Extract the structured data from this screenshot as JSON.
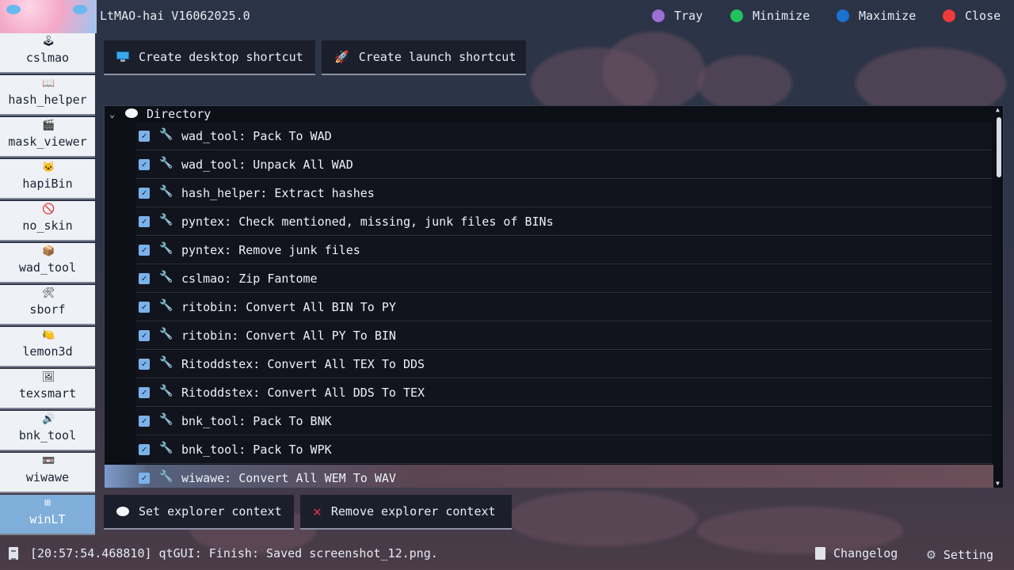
{
  "app": {
    "title": "LtMAO-hai V16062025.0"
  },
  "window_controls": [
    {
      "label": "Tray",
      "color": "#9b6fd4"
    },
    {
      "label": "Minimize",
      "color": "#23c25e"
    },
    {
      "label": "Maximize",
      "color": "#1a73d0"
    },
    {
      "label": "Close",
      "color": "#ef3b3b"
    }
  ],
  "sidebar": {
    "items": [
      {
        "label": "cslmao",
        "icon": "joystick-icon",
        "glyph": "🕹",
        "active": false
      },
      {
        "label": "hash_helper",
        "icon": "open-book-icon",
        "glyph": "📖",
        "active": false
      },
      {
        "label": "mask_viewer",
        "icon": "clapper-board-icon",
        "glyph": "🎬",
        "active": false
      },
      {
        "label": "hapiBin",
        "icon": "cat-face-icon",
        "glyph": "🐱",
        "active": false
      },
      {
        "label": "no_skin",
        "icon": "no-entry-icon",
        "glyph": "🚫",
        "active": false
      },
      {
        "label": "wad_tool",
        "icon": "package-icon",
        "glyph": "📦",
        "active": false
      },
      {
        "label": "sborf",
        "icon": "hammer-wrench-icon",
        "glyph": "🛠",
        "active": false
      },
      {
        "label": "lemon3d",
        "icon": "lemon-icon",
        "glyph": "🍋",
        "active": false
      },
      {
        "label": "texsmart",
        "icon": "picture-icon",
        "glyph": "🖼",
        "active": false
      },
      {
        "label": "bnk_tool",
        "icon": "speaker-icon",
        "glyph": "🔊",
        "active": false
      },
      {
        "label": "wiwawe",
        "icon": "cassette-icon",
        "glyph": "📼",
        "active": false
      },
      {
        "label": "winLT",
        "icon": "windows-icon",
        "glyph": "⊞",
        "active": true
      }
    ]
  },
  "top_buttons": {
    "desktop": {
      "label": "Create desktop shortcut",
      "icon": "monitor-icon"
    },
    "launch": {
      "label": "Create launch shortcut",
      "icon": "rocket-icon"
    }
  },
  "list": {
    "group_label": "Directory",
    "items": [
      {
        "label": "wad_tool: Pack To WAD",
        "checked": true
      },
      {
        "label": "wad_tool: Unpack All WAD",
        "checked": true
      },
      {
        "label": "hash_helper: Extract hashes",
        "checked": true
      },
      {
        "label": "pyntex: Check mentioned, missing, junk files of BINs",
        "checked": true
      },
      {
        "label": "pyntex: Remove junk files",
        "checked": true
      },
      {
        "label": "cslmao: Zip Fantome",
        "checked": true
      },
      {
        "label": "ritobin: Convert All BIN To PY",
        "checked": true
      },
      {
        "label": "ritobin: Convert All PY To BIN",
        "checked": true
      },
      {
        "label": "Ritoddstex: Convert All TEX To DDS",
        "checked": true
      },
      {
        "label": "Ritoddstex: Convert All DDS To TEX",
        "checked": true
      },
      {
        "label": "bnk_tool: Pack To BNK",
        "checked": true
      },
      {
        "label": "bnk_tool: Pack To WPK",
        "checked": true
      },
      {
        "label": "wiwawe: Convert All WEM To WAV",
        "checked": true,
        "selected": true
      }
    ]
  },
  "bottom_buttons": {
    "set": {
      "label": "Set explorer context",
      "icon": "speech-bubble-icon"
    },
    "remove": {
      "label": "Remove explorer context",
      "icon": "cross-mark-icon"
    }
  },
  "status": {
    "log": "[20:57:54.468810] qtGUI: Finish: Saved screenshot_12.png.",
    "changelog": "Changelog",
    "setting": "Setting"
  }
}
